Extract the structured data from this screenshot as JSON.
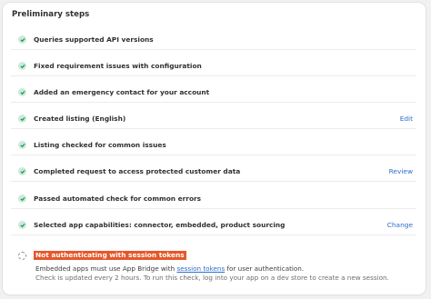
{
  "title": "Preliminary steps",
  "colors": {
    "success_icon_bg": "#c9ecd9",
    "success_icon": "#1a7f4b",
    "link": "#2c6ecb",
    "highlight": "#e4582b"
  },
  "steps": [
    {
      "label": "Queries supported API versions",
      "action": "",
      "icon": "checkmark-circle-icon"
    },
    {
      "label": "Fixed requirement issues with configuration",
      "action": "",
      "icon": "checkmark-circle-icon"
    },
    {
      "label": "Added an emergency contact for your account",
      "action": "",
      "icon": "checkmark-circle-icon"
    },
    {
      "label": "Created listing (English)",
      "action": "Edit",
      "icon": "checkmark-circle-icon"
    },
    {
      "label": "Listing checked for common issues",
      "action": "",
      "icon": "checkmark-circle-icon"
    },
    {
      "label": "Completed request to access protected customer data",
      "action": "Review",
      "icon": "checkmark-circle-icon"
    },
    {
      "label": "Passed automated check for common errors",
      "action": "",
      "icon": "checkmark-circle-icon"
    },
    {
      "label": "Selected app capabilities: connector, embedded, product sourcing",
      "action": "Change",
      "icon": "checkmark-circle-icon"
    }
  ],
  "pending": {
    "icon": "dashed-circle-icon",
    "title": "Not authenticating with session tokens",
    "desc_before": "Embedded apps must use App Bridge with ",
    "desc_link": "session tokens",
    "desc_after": " for user authentication.",
    "note": "Check is updated every 2 hours. To run this check, log into your app on a dev store to create a new session."
  }
}
